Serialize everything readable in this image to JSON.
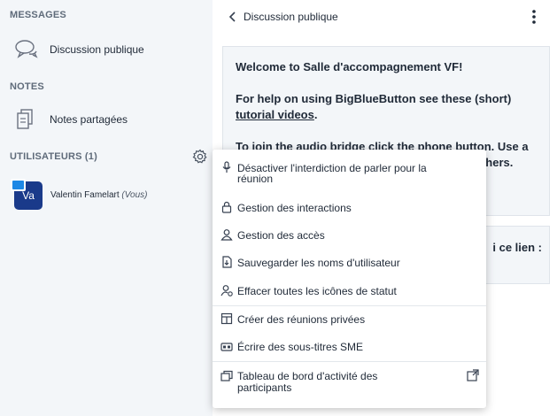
{
  "sidebar": {
    "messages_title": "MESSAGES",
    "public_chat_label": "Discussion publique",
    "notes_title": "NOTES",
    "shared_notes_label": "Notes partagées",
    "users_title": "UTILISATEURS (1)",
    "user": {
      "initials": "Va",
      "name": "Valentin Famelart",
      "you_label": "(Vous)"
    }
  },
  "chat": {
    "title": "Discussion publique",
    "welcome_line1": "Welcome to Salle d'accompagnement VF!",
    "welcome_line2": "For help on using BigBlueButton see these (short)",
    "tutorial_link": "tutorial videos",
    "welcome_line2_end": ".",
    "welcome_line3": "To join the audio bridge click the phone button. Use a",
    "welcome_line3b": "others.",
    "second_msg": "i ce lien :"
  },
  "menu": {
    "items": [
      {
        "label": "Désactiver l'interdiction de parler pour la",
        "label2": "réunion",
        "icon": "microphone-icon"
      },
      {
        "label": "Gestion des interactions",
        "icon": "lock-icon"
      },
      {
        "label": "Gestion des accès",
        "icon": "user-icon"
      },
      {
        "label": "Sauvegarder les noms d'utilisateur",
        "icon": "download-icon"
      },
      {
        "label": "Effacer toutes les icônes de statut",
        "icon": "clear-status-icon"
      },
      {
        "label": "Créer des réunions privées",
        "icon": "rooms-icon"
      },
      {
        "label": "Écrire des sous-titres SME",
        "icon": "closed-caption-icon"
      },
      {
        "label": "Tableau de bord d'activité des",
        "label2": "participants",
        "icon": "dashboard-icon"
      }
    ]
  },
  "colors": {
    "sidebar_bg": "#f3f6f9",
    "avatar_bg": "#1a3a8a",
    "badge": "#1e88e5"
  }
}
